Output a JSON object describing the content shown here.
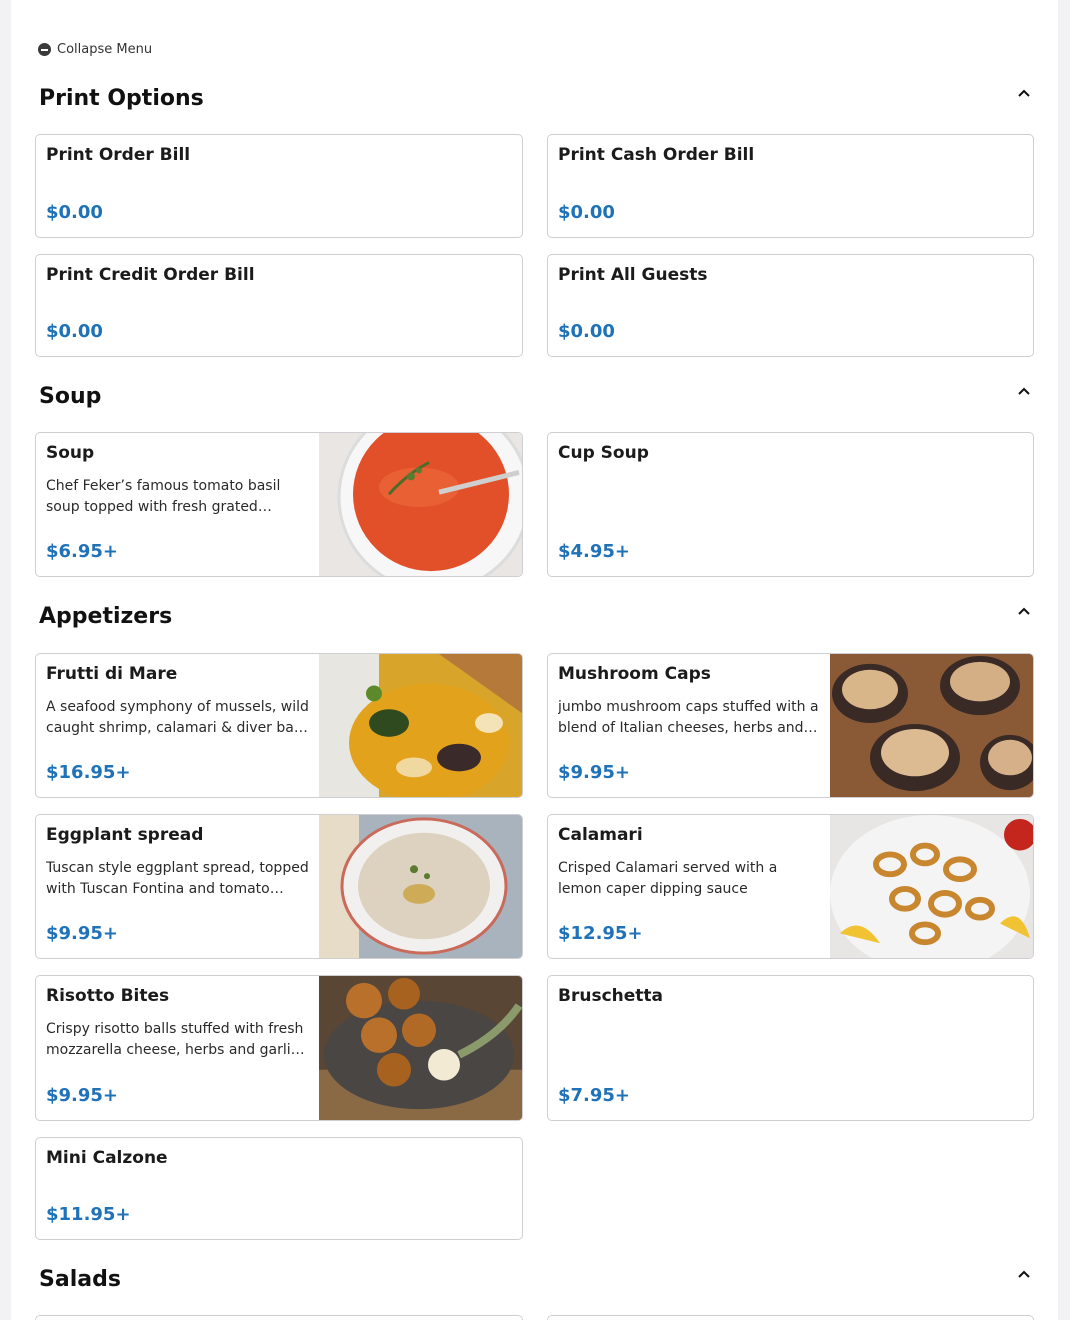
{
  "collapse_label": "Collapse Menu",
  "sections": {
    "print": {
      "title": "Print Options",
      "items": [
        {
          "name": "Print Order Bill",
          "price": "$0.00"
        },
        {
          "name": "Print Cash Order Bill",
          "price": "$0.00"
        },
        {
          "name": "Print Credit Order Bill",
          "price": "$0.00"
        },
        {
          "name": "Print All Guests",
          "price": "$0.00"
        }
      ]
    },
    "soup": {
      "title": "Soup",
      "items": [
        {
          "name": "Soup",
          "desc": "Chef Feker’s famous tomato basil soup topped with fresh grated…",
          "price": "$6.95+",
          "image": "tomato-basil-soup-photo"
        },
        {
          "name": "Cup Soup",
          "price": "$4.95+"
        }
      ]
    },
    "appetizers": {
      "title": "Appetizers",
      "items": [
        {
          "name": "Frutti di Mare",
          "desc": "A seafood symphony of mussels, wild caught shrimp, calamari & diver ba…",
          "price": "$16.95+",
          "image": "seafood-stew-photo"
        },
        {
          "name": "Mushroom Caps",
          "desc": "jumbo mushroom caps stuffed with a blend of Italian cheeses, herbs and…",
          "price": "$9.95+",
          "image": "stuffed-mushrooms-photo"
        },
        {
          "name": "Eggplant spread",
          "desc": "Tuscan style eggplant spread, topped with Tuscan Fontina and tomato…",
          "price": "$9.95+",
          "image": "eggplant-spread-photo"
        },
        {
          "name": "Calamari",
          "desc": "Crisped Calamari served with a lemon caper dipping sauce",
          "price": "$12.95+",
          "image": "fried-calamari-photo"
        },
        {
          "name": "Risotto Bites",
          "desc": "Crispy risotto balls stuffed with fresh mozzarella cheese, herbs and garli…",
          "price": "$9.95+",
          "image": "risotto-balls-photo"
        },
        {
          "name": "Bruschetta",
          "price": "$7.95+"
        },
        {
          "name": "Mini Calzone",
          "price": "$11.95+"
        }
      ]
    },
    "salads": {
      "title": "Salads"
    }
  },
  "colors": {
    "price": "#1f72b8",
    "border": "#cfcfd3",
    "background": "#f2f2f4"
  },
  "icons": {
    "collapse": "minus-circle-icon",
    "section_toggle": "chevron-up-icon"
  }
}
